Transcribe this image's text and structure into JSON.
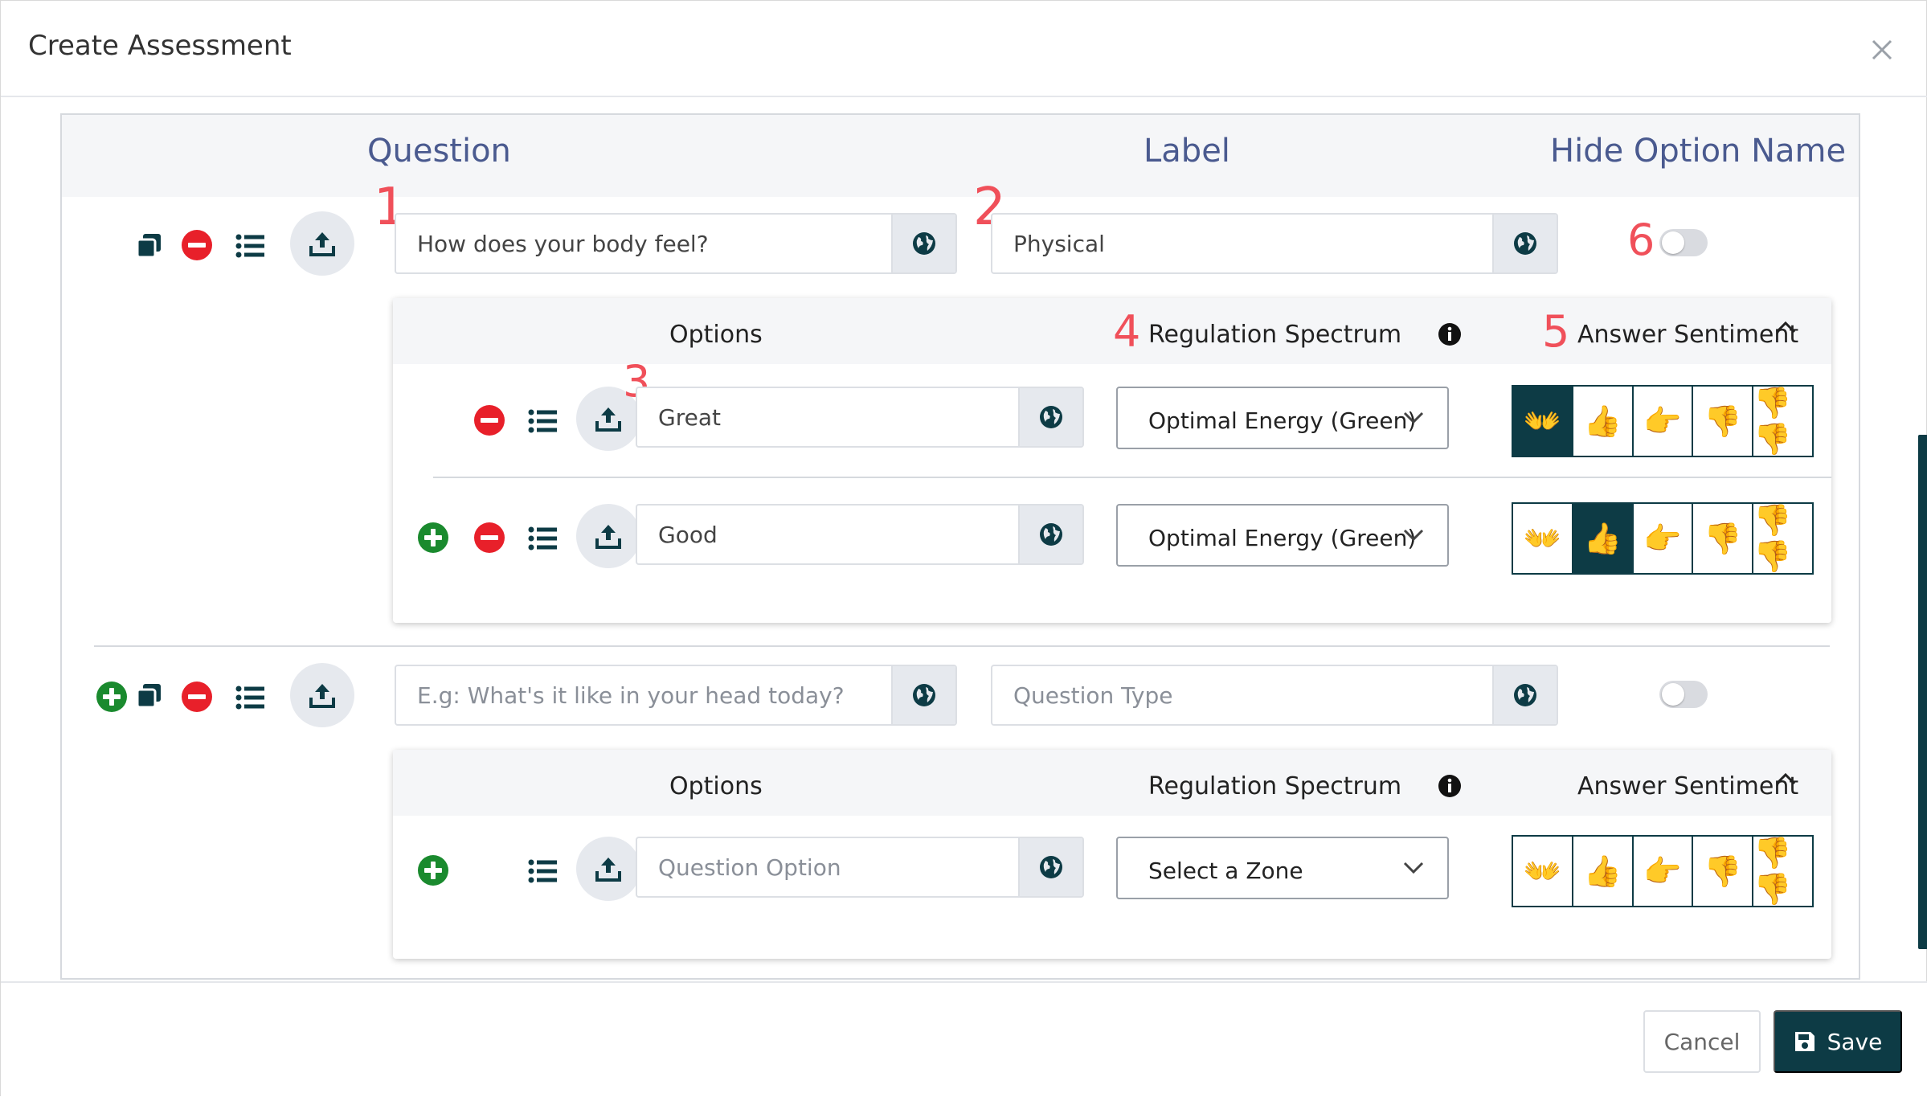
{
  "modal": {
    "title": "Create Assessment"
  },
  "columns": {
    "question": "Question",
    "label": "Label",
    "hide_option_name": "Hide Option Name"
  },
  "annotations": [
    "1",
    "2",
    "3",
    "4",
    "5",
    "6"
  ],
  "questions": [
    {
      "question_value": "How does your body feel?",
      "question_placeholder": "",
      "label_value": "Physical",
      "label_placeholder": "",
      "hide_option_name": false,
      "options_header": {
        "options": "Options",
        "regulation": "Regulation Spectrum",
        "sentiment": "Answer Sentiment"
      },
      "options": [
        {
          "value": "Great",
          "placeholder": "",
          "zone": "Optimal Energy (Green)",
          "sentiment_selected_index": 0
        },
        {
          "value": "Good",
          "placeholder": "",
          "zone": "Optimal Energy (Green)",
          "sentiment_selected_index": 1
        }
      ]
    },
    {
      "question_value": "",
      "question_placeholder": "E.g: What's it like in your head today?",
      "label_value": "",
      "label_placeholder": "Question Type",
      "hide_option_name": false,
      "options_header": {
        "options": "Options",
        "regulation": "Regulation Spectrum",
        "sentiment": "Answer Sentiment"
      },
      "options": [
        {
          "value": "",
          "placeholder": "Question Option",
          "zone": "Select a Zone",
          "sentiment_selected_index": -1
        }
      ]
    }
  ],
  "sentiment_icons": [
    "👐",
    "👍",
    "👉",
    "👎",
    "👎👎"
  ],
  "colors": {
    "brand": "#0d3b45",
    "remove": "#e8202a",
    "add": "#1a8a2e",
    "annotation": "#f0505a",
    "column_title": "#4a5a8f"
  },
  "footer": {
    "cancel_label": "Cancel",
    "save_label": "Save"
  }
}
